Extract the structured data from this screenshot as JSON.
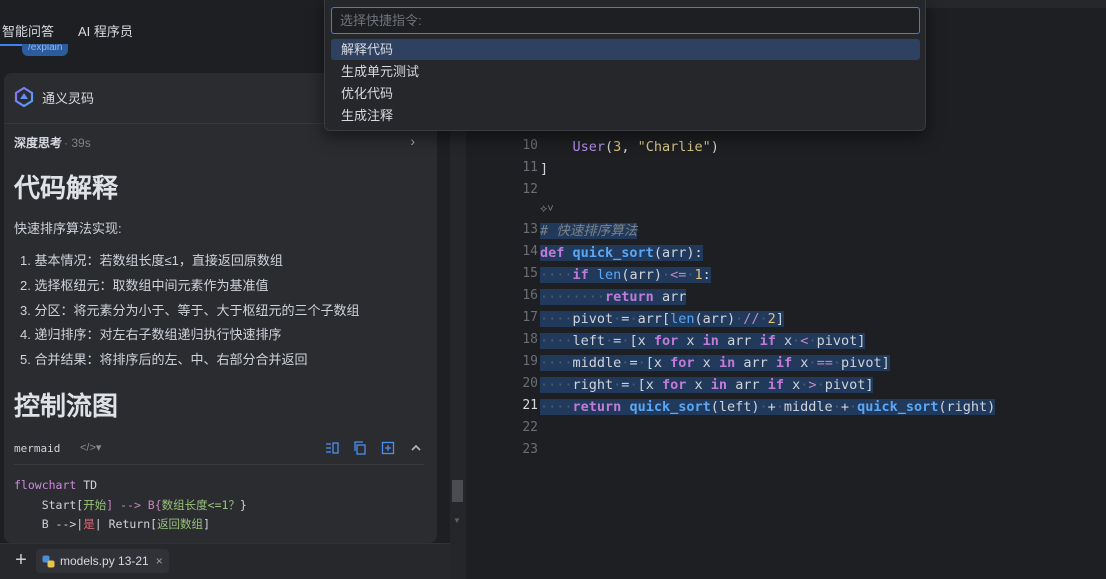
{
  "tabs": [
    {
      "label": "智能问答"
    },
    {
      "label": "AI 程序员"
    }
  ],
  "explain_tag": "/explain",
  "assistant": {
    "name": "通义灵码",
    "thinking_label": "深度思考",
    "thinking_time": "· 39s",
    "section1_title": "代码解释",
    "intro": "快速排序算法实现:",
    "steps": [
      "1. 基本情况：若数组长度≤1，直接返回原数组",
      "2. 选择枢纽元：取数组中间元素作为基准值",
      "3. 分区：将元素分为小于、等于、大于枢纽元的三个子数组",
      "4. 递归排序：对左右子数组递归执行快速排序",
      "5. 合并结果：将排序后的左、中、右部分合并返回"
    ],
    "section2_title": "控制流图",
    "code_block": {
      "language": "mermaid",
      "format_icon": "</>▾",
      "lines": {
        "l1_kw": "flowchart",
        "l1_rest": " TD",
        "l2_a": "    Start[",
        "l2_b": "开始",
        "l2_c": "] --> B{",
        "l2_d": "数组长度<=1？",
        "l2_e": "}",
        "l3_a": "    B -->|",
        "l3_b": "是",
        "l3_c": "| Return[",
        "l3_d": "返回数组",
        "l3_e": "]"
      }
    }
  },
  "attachment": {
    "file": "models.py 13-21",
    "close": "×"
  },
  "command_palette": {
    "placeholder": "选择快捷指令:",
    "items": [
      "解释代码",
      "生成单元测试",
      "优化代码",
      "生成注释"
    ],
    "active_index": 0
  },
  "editor": {
    "line_numbers": [
      "10",
      "11",
      "12",
      "13",
      "14",
      "15",
      "16",
      "17",
      "18",
      "19",
      "20",
      "21",
      "22",
      "23"
    ],
    "current_line": "21",
    "code": {
      "l10_a": "User",
      "l10_b": "(",
      "l10_c": "3",
      "l10_d": ", ",
      "l10_e": "\"Charlie\"",
      "l10_f": ")",
      "l11": "]",
      "l13": "# 快速排序算法",
      "l14_def": "def",
      "l14_fn": "quick_sort",
      "l14_rest": "(arr):",
      "l15_if": "if",
      "l15_len": "len",
      "l15_a": "(arr)",
      "l15_op": "<=",
      "l15_num": "1",
      "l15_c": ":",
      "l16_ret": "return",
      "l16_rest": "arr",
      "l17_a": "pivot",
      "l17_b": "=",
      "l17_c": "arr[",
      "l17_len": "len",
      "l17_d": "(arr)",
      "l17_op": "//",
      "l17_num": "2",
      "l17_e": "]",
      "l18_a": "left",
      "l18_b": "=",
      "l18_c": "[x",
      "l18_for": "for",
      "l18_d": "x",
      "l18_in": "in",
      "l18_e": "arr",
      "l18_if": "if",
      "l18_f": "x",
      "l18_op": "<",
      "l18_g": "pivot]",
      "l19_a": "middle",
      "l19_b": "=",
      "l19_c": "[x",
      "l19_for": "for",
      "l19_d": "x",
      "l19_in": "in",
      "l19_e": "arr",
      "l19_if": "if",
      "l19_f": "x",
      "l19_op": "==",
      "l19_g": "pivot]",
      "l20_a": "right",
      "l20_b": "=",
      "l20_c": "[x",
      "l20_for": "for",
      "l20_d": "x",
      "l20_in": "in",
      "l20_e": "arr",
      "l20_if": "if",
      "l20_f": "x",
      "l20_op": ">",
      "l20_g": "pivot]",
      "l21_ret": "return",
      "l21_fn1": "quick_sort",
      "l21_a": "(left)",
      "l21_p1": "+",
      "l21_b": "middle",
      "l21_p2": "+",
      "l21_fn2": "quick_sort",
      "l21_c": "(right)"
    }
  },
  "colors": {
    "accent": "#3d7fe0",
    "selection": "#213a5c",
    "keyword": "#c27ad8",
    "function": "#5aa7f5"
  }
}
